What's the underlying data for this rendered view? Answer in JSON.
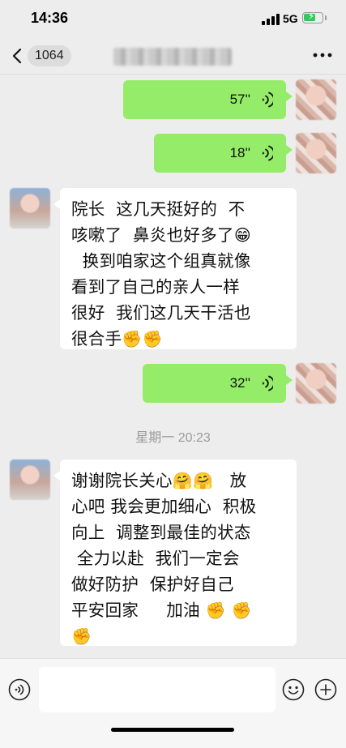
{
  "status_bar": {
    "time": "14:36",
    "network": "5G",
    "battery_level": 0.65
  },
  "nav": {
    "unread_count": "1064",
    "title": ""
  },
  "messages": [
    {
      "type": "voice",
      "direction": "out",
      "duration": "57''"
    },
    {
      "type": "voice",
      "direction": "out",
      "duration": "18''"
    },
    {
      "type": "text",
      "direction": "in",
      "lines": [
        "院长  这几天挺好的  不",
        "咳嗽了  鼻炎也好多了",
        "  换到咱家这个组真就像",
        "看到了自己的亲人一样",
        "很好  我们这几天干活也",
        "很合手"
      ],
      "emojis": {
        "grin": "😁",
        "fist": "✊"
      }
    },
    {
      "type": "voice",
      "direction": "out",
      "duration": "32''"
    },
    {
      "type": "text",
      "direction": "in",
      "lines": [
        "谢谢院长关心",
        "   放",
        "心吧 我会更加细心  积极",
        "向上  调整到最佳的状态",
        " 全力以赴  我们一定会",
        "做好防护  保护好自己",
        "平安回家     加油 "
      ],
      "emojis": {
        "hug": "🤗",
        "fist": "✊"
      }
    }
  ],
  "timestamp": "星期一 20:23",
  "icons": {
    "back": "chevron-left-icon",
    "more": "more-dots-icon",
    "voice_wave": "voice-wave-icon",
    "voice_toggle": "voice-input-icon",
    "emoji": "emoji-icon",
    "plus": "plus-icon"
  },
  "colors": {
    "background": "#ededed",
    "outgoing_bubble": "#95ec69",
    "incoming_bubble": "#ffffff",
    "battery_fill": "#34c759"
  }
}
